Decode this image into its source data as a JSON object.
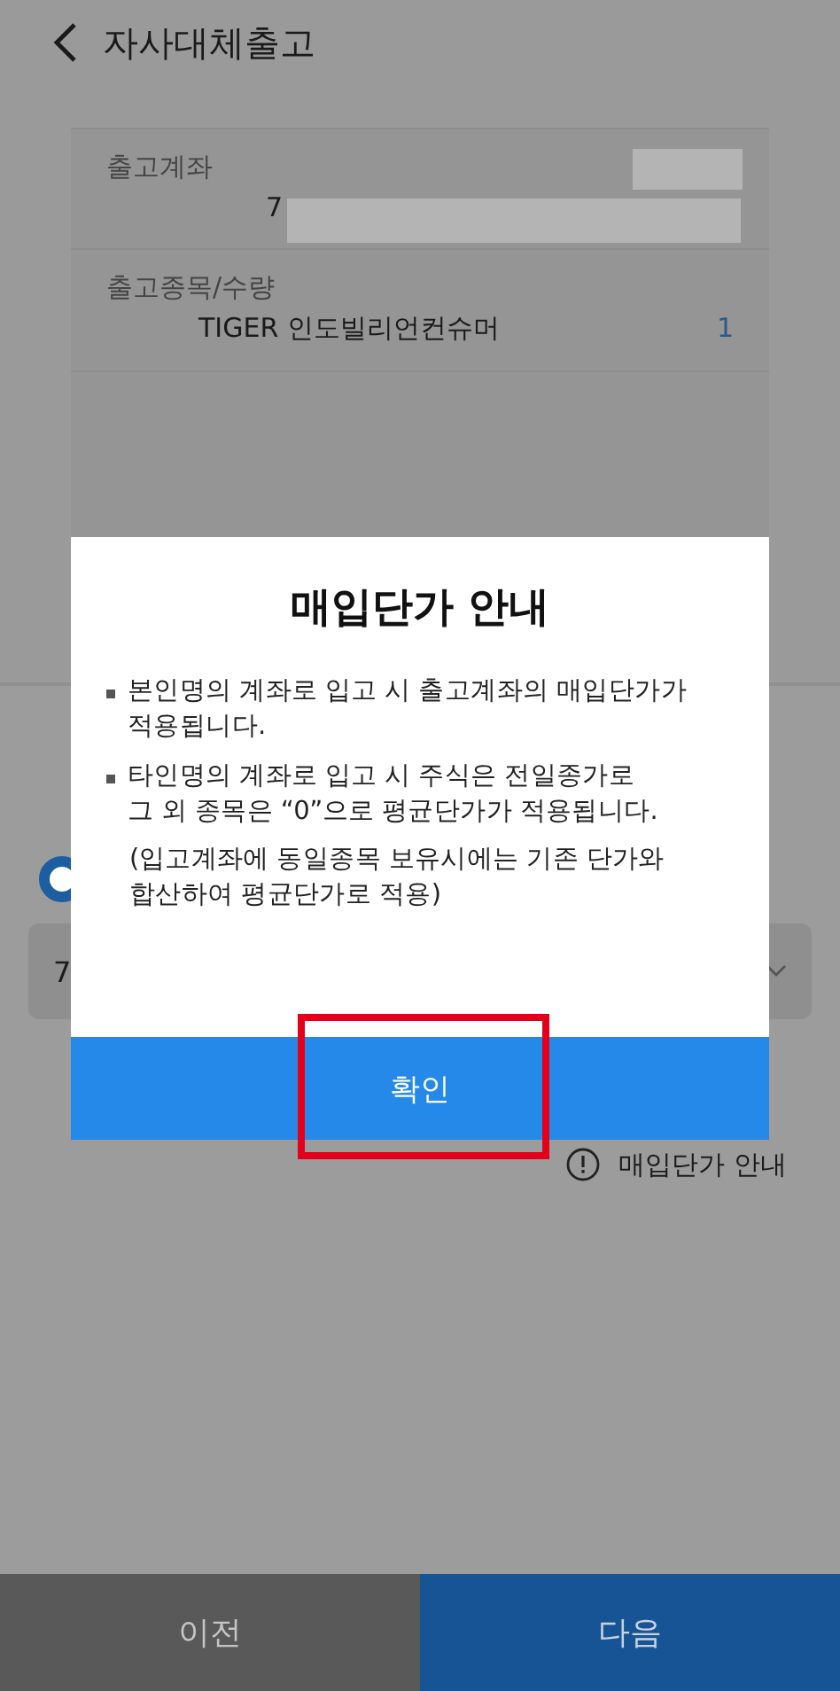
{
  "header": {
    "title": "자사대체출고"
  },
  "summary": {
    "rows": [
      {
        "label": "출고계좌",
        "value": "7"
      },
      {
        "label": "출고종목/수량",
        "value": "TIGER 인도빌리언컨슈머",
        "quantity": "1"
      }
    ]
  },
  "form": {
    "radio": {
      "selected": true
    },
    "account_select": {
      "value": "7"
    },
    "info_link": "매입단가 안내"
  },
  "dialog": {
    "title": "매입단가 안내",
    "bullets": [
      "본인명의 계좌로 입고 시 출고계좌의 매입단가가\n적용됩니다.",
      "타인명의 계좌로 입고 시 주식은 전일종가로\n그 외 종목은 “0”으로 평균단가가 적용됩니다."
    ],
    "note": "(입고계좌에 동일종목 보유시에는 기존 단가와\n합산하여 평균단가로 적용)",
    "confirm": "확인",
    "confirm_highlighted": true
  },
  "footer": {
    "buttons": [
      {
        "label": "이전",
        "kind": "secondary"
      },
      {
        "label": "다음",
        "kind": "primary"
      }
    ]
  }
}
